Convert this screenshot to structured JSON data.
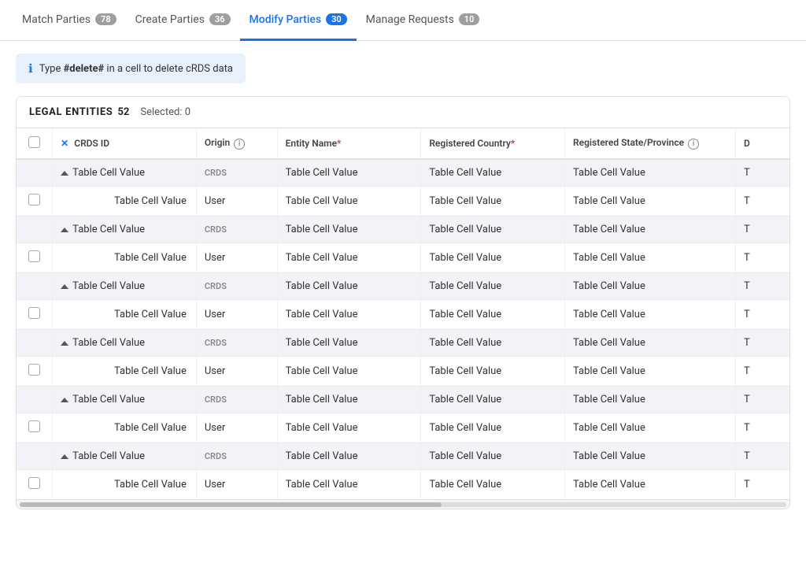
{
  "tabs": [
    {
      "id": "match",
      "label": "Match Parties",
      "badge": "78",
      "active": false
    },
    {
      "id": "create",
      "label": "Create Parties",
      "badge": "36",
      "active": false
    },
    {
      "id": "modify",
      "label": "Modify Parties",
      "badge": "30",
      "active": true
    },
    {
      "id": "manage",
      "label": "Manage Requests",
      "badge": "10",
      "active": false
    }
  ],
  "banner": {
    "text_prefix": "Type ",
    "highlight": "#delete#",
    "text_suffix": " in a cell to delete cRDS data"
  },
  "table": {
    "section_title": "LEGAL ENTITIES",
    "count": "52",
    "selected_label": "Selected: 0",
    "columns": [
      {
        "id": "check",
        "label": "",
        "class": "col-check"
      },
      {
        "id": "crds_id",
        "label": "CRDS ID",
        "required": false,
        "info": false,
        "class": "col-crds"
      },
      {
        "id": "origin",
        "label": "Origin",
        "required": false,
        "info": true,
        "class": "col-origin"
      },
      {
        "id": "entity_name",
        "label": "Entity Name",
        "required": true,
        "info": false,
        "class": "col-entity"
      },
      {
        "id": "reg_country",
        "label": "Registered Country",
        "required": true,
        "info": false,
        "class": "col-country"
      },
      {
        "id": "reg_state",
        "label": "Registered State/Province",
        "required": false,
        "info": true,
        "class": "col-state"
      },
      {
        "id": "d",
        "label": "D",
        "required": false,
        "info": false,
        "class": "col-d"
      }
    ],
    "rows": [
      {
        "type": "crds",
        "crds_id": "Table Cell Value",
        "origin": "CRDS",
        "entity_name": "Table Cell Value",
        "reg_country": "Table Cell Value",
        "reg_state": "Table Cell Value",
        "d": "T"
      },
      {
        "type": "user",
        "crds_id": "Table Cell Value",
        "origin": "User",
        "entity_name": "Table Cell Value",
        "reg_country": "Table Cell Value",
        "reg_state": "Table Cell Value",
        "d": "T"
      },
      {
        "type": "crds",
        "crds_id": "Table Cell Value",
        "origin": "CRDS",
        "entity_name": "Table Cell Value",
        "reg_country": "Table Cell Value",
        "reg_state": "Table Cell Value",
        "d": "T"
      },
      {
        "type": "user",
        "crds_id": "Table Cell Value",
        "origin": "User",
        "entity_name": "Table Cell Value",
        "reg_country": "Table Cell Value",
        "reg_state": "Table Cell Value",
        "d": "T"
      },
      {
        "type": "crds",
        "crds_id": "Table Cell Value",
        "origin": "CRDS",
        "entity_name": "Table Cell Value",
        "reg_country": "Table Cell Value",
        "reg_state": "Table Cell Value",
        "d": "T"
      },
      {
        "type": "user",
        "crds_id": "Table Cell Value",
        "origin": "User",
        "entity_name": "Table Cell Value",
        "reg_country": "Table Cell Value",
        "reg_state": "Table Cell Value",
        "d": "T"
      },
      {
        "type": "crds",
        "crds_id": "Table Cell Value",
        "origin": "CRDS",
        "entity_name": "Table Cell Value",
        "reg_country": "Table Cell Value",
        "reg_state": "Table Cell Value",
        "d": "T"
      },
      {
        "type": "user",
        "crds_id": "Table Cell Value",
        "origin": "User",
        "entity_name": "Table Cell Value",
        "reg_country": "Table Cell Value",
        "reg_state": "Table Cell Value",
        "d": "T"
      },
      {
        "type": "crds",
        "crds_id": "Table Cell Value",
        "origin": "CRDS",
        "entity_name": "Table Cell Value",
        "reg_country": "Table Cell Value",
        "reg_state": "Table Cell Value",
        "d": "T"
      },
      {
        "type": "user",
        "crds_id": "Table Cell Value",
        "origin": "User",
        "entity_name": "Table Cell Value",
        "reg_country": "Table Cell Value",
        "reg_state": "Table Cell Value",
        "d": "T"
      },
      {
        "type": "crds",
        "crds_id": "Table Cell Value",
        "origin": "CRDS",
        "entity_name": "Table Cell Value",
        "reg_country": "Table Cell Value",
        "reg_state": "Table Cell Value",
        "d": "T"
      },
      {
        "type": "user",
        "crds_id": "Table Cell Value",
        "origin": "User",
        "entity_name": "Table Cell Value",
        "reg_country": "Table Cell Value",
        "reg_state": "Table Cell Value",
        "d": "T"
      }
    ]
  }
}
